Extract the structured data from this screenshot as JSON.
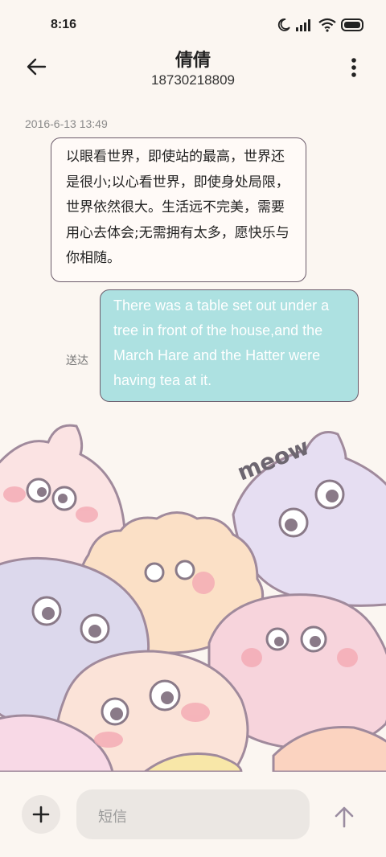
{
  "status": {
    "time": "8:16"
  },
  "header": {
    "title": "倩倩",
    "subtitle": "18730218809"
  },
  "conversation": {
    "timestamp": "2016-6-13 13:49",
    "incoming": "以眼看世界，即使站的最高，世界还是很小;以心看世界，即使身处局限，世界依然很大。生活远不完美，需要用心去体会;无需拥有太多，愿快乐与你相随。",
    "outgoing": "There was a table set out under a tree in front of the house,and the March Hare and the Hatter were having tea at it.",
    "outgoing_status": "送达"
  },
  "illustration": {
    "text": "meow"
  },
  "composer": {
    "placeholder": "短信"
  },
  "icons": [
    "back-arrow-icon",
    "more-icon",
    "moon-icon",
    "signal-icon",
    "wifi-icon",
    "battery-icon",
    "plus-icon",
    "send-icon"
  ]
}
